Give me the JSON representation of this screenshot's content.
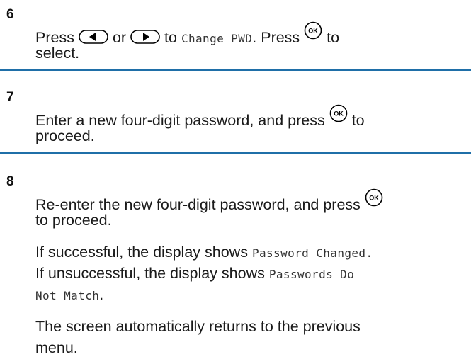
{
  "steps": [
    {
      "number": "6",
      "lines": [
        {
          "press": "Press",
          "or": "or",
          "to": "to",
          "menu_item": "Change PWD",
          "press2": ". Press",
          "to2": "to"
        },
        {
          "text": "select."
        }
      ]
    },
    {
      "number": "7",
      "line1_text": "Enter a new four-digit password, and press",
      "line1_to": "to",
      "line2_text": "proceed."
    },
    {
      "number": "8",
      "line1_text": "Re-enter the new four-digit password, and press",
      "line2_text": "to proceed.",
      "result": {
        "success_prefix": "If successful, the display shows",
        "success_msg": "Password Changed.",
        "fail_prefix": "If unsuccessful, the display shows",
        "fail_msg_line1": "Passwords Do",
        "fail_msg_line2": "Not Match",
        "fail_end": "."
      },
      "return_line1": "The screen automatically returns to the previous",
      "return_line2": "menu."
    }
  ],
  "icons": {
    "left": "left-arrow-button-icon",
    "right": "right-arrow-button-icon",
    "ok": "ok-button-icon"
  },
  "colors": {
    "rule": "#1f6fa8",
    "text": "#1a1a1a"
  }
}
